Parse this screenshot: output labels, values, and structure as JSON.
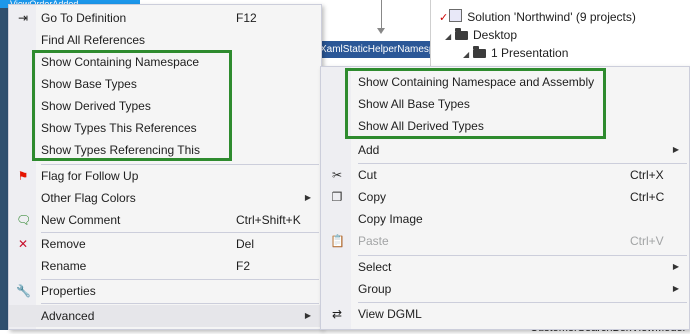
{
  "background": {
    "top_tab": "ViewOrderAdded",
    "xaml_label": "XamlStaticHelperNamespace",
    "solution_explorer": {
      "solution": "Solution 'Northwind' (9 projects)",
      "folder": "Desktop",
      "project": "1 Presentation"
    },
    "bottom_text": "CustomerSearchBoxViewModel"
  },
  "primary_menu": {
    "items": [
      {
        "label": "Go To Definition",
        "shortcut": "F12",
        "icon": "go-to-definition-icon"
      },
      {
        "label": "Find All References"
      },
      {
        "label": "Show Containing Namespace"
      },
      {
        "label": "Show Base Types"
      },
      {
        "label": "Show Derived Types"
      },
      {
        "label": "Show Types This References"
      },
      {
        "label": "Show Types Referencing This"
      },
      {
        "label": "Flag for Follow Up",
        "icon": "flag-icon"
      },
      {
        "label": "Other Flag Colors",
        "submenu": true
      },
      {
        "label": "New Comment",
        "shortcut": "Ctrl+Shift+K",
        "icon": "comment-icon"
      },
      {
        "label": "Remove",
        "shortcut": "Del",
        "icon": "remove-icon"
      },
      {
        "label": "Rename",
        "shortcut": "F2"
      },
      {
        "label": "Properties",
        "icon": "wrench-icon"
      },
      {
        "label": "Advanced",
        "submenu": true
      }
    ]
  },
  "sub_menu": {
    "items": [
      {
        "label": "Show Containing Namespace and Assembly"
      },
      {
        "label": "Show All Base Types"
      },
      {
        "label": "Show All Derived Types"
      },
      {
        "label": "Add",
        "submenu": true
      },
      {
        "label": "Cut",
        "shortcut": "Ctrl+X",
        "icon": "scissors-icon"
      },
      {
        "label": "Copy",
        "shortcut": "Ctrl+C",
        "icon": "copy-icon"
      },
      {
        "label": "Copy Image"
      },
      {
        "label": "Paste",
        "shortcut": "Ctrl+V",
        "icon": "paste-icon",
        "disabled": true
      },
      {
        "label": "Select",
        "submenu": true
      },
      {
        "label": "Group",
        "submenu": true
      },
      {
        "label": "View DGML",
        "icon": "dgml-icon"
      }
    ]
  },
  "colors": {
    "highlight_border": "#2e8b2e",
    "menu_background": "#f5f5f5",
    "menu_gutter": "#eeeef2",
    "disabled_text": "#a2a4a5",
    "flag": "#e51400"
  }
}
